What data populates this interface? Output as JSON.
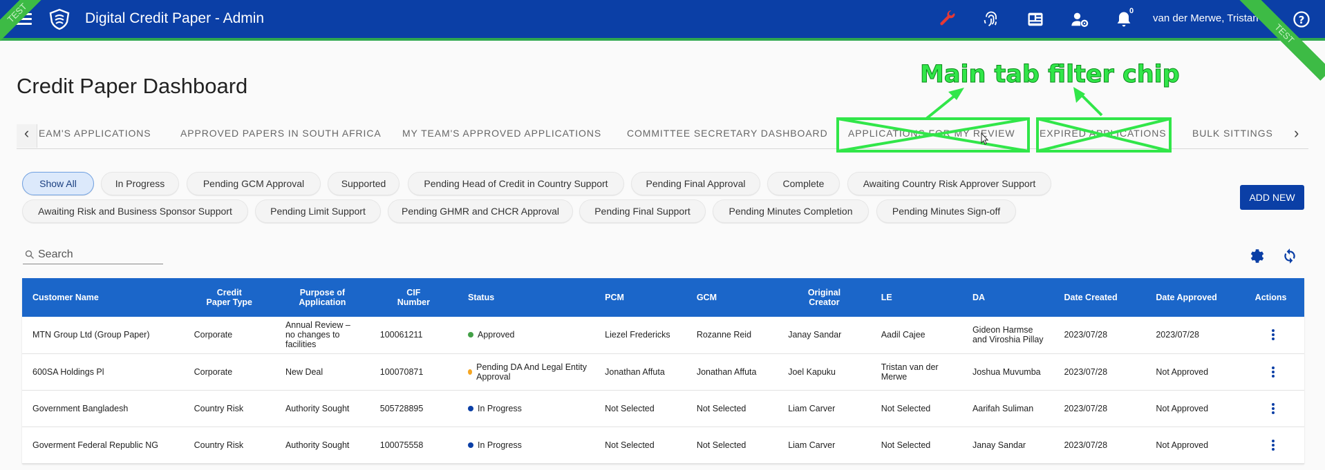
{
  "header": {
    "app_title": "Digital Credit Paper - Admin",
    "user_name": "van der Merwe, Tristan T",
    "notification_count": "0",
    "env_ribbon_left": "TEST",
    "env_ribbon_right": "TEST",
    "icons": [
      "menu-icon",
      "bank-shield-logo",
      "wrench-icon",
      "fingerprint-icon",
      "id-card-icon",
      "user-settings-icon",
      "bell-icon",
      "help-icon"
    ],
    "wrench_color": "#e53935",
    "bar_color": "#0b3fa6",
    "stripe_color": "#2fa84f"
  },
  "page": {
    "title": "Credit Paper Dashboard"
  },
  "tabs": [
    {
      "label": "EAM'S APPLICATIONS"
    },
    {
      "label": "APPROVED PAPERS IN SOUTH AFRICA"
    },
    {
      "label": "MY TEAM'S APPROVED APPLICATIONS"
    },
    {
      "label": "COMMITTEE SECRETARY DASHBOARD"
    },
    {
      "label": "APPLICATIONS FOR MY REVIEW"
    },
    {
      "label": "EXPIRED APPLICATIONS"
    },
    {
      "label": "BULK SITTINGS"
    }
  ],
  "annotation": {
    "label": "Main tab filter chip",
    "color": "#31e649"
  },
  "filters": {
    "active": "Show All",
    "chips": [
      "Show All",
      "In Progress",
      "Pending GCM Approval",
      "Supported",
      "Pending Head of Credit in Country Support",
      "Pending Final Approval",
      "Complete",
      "Awaiting Country Risk Approver Support",
      "Awaiting Risk and Business Sponsor Support",
      "Pending Limit Support",
      "Pending GHMR and CHCR Approval",
      "Pending Final Support",
      "Pending Minutes Completion",
      "Pending Minutes Sign-off"
    ]
  },
  "actions": {
    "add_new_label": "ADD NEW"
  },
  "search": {
    "placeholder": "Search",
    "value": ""
  },
  "table": {
    "columns": [
      "Customer Name",
      "Credit Paper Type",
      "Purpose of Application",
      "CIF Number",
      "Status",
      "PCM",
      "GCM",
      "Original Creator",
      "LE",
      "DA",
      "Date Created",
      "Date Approved",
      "Actions"
    ],
    "rows": [
      {
        "customer": "MTN Group Ltd (Group Paper)",
        "type": "Corporate",
        "purpose": "Annual Review – no changes to facilities",
        "cif": "100061211",
        "status": "Approved",
        "status_color": "#43a047",
        "pcm": "Liezel Fredericks",
        "gcm": "Rozanne Reid",
        "creator": "Janay Sandar",
        "le": "Aadil Cajee",
        "da": "Gideon Harmse and Viroshia Pillay",
        "created": "2023/07/28",
        "approved": "2023/07/28"
      },
      {
        "customer": "600SA Holdings Pl",
        "type": "Corporate",
        "purpose": "New Deal",
        "cif": "100070871",
        "status": "Pending DA And Legal Entity Approval",
        "status_color": "#f5a623",
        "pcm": "Jonathan Affuta",
        "gcm": "Jonathan Affuta",
        "creator": "Joel Kapuku",
        "le": "Tristan van der Merwe",
        "da": "Joshua Muvumba",
        "created": "2023/07/28",
        "approved": "Not Approved"
      },
      {
        "customer": "Government Bangladesh",
        "type": "Country Risk",
        "purpose": "Authority Sought",
        "cif": "505728895",
        "status": "In Progress",
        "status_color": "#0b3fa6",
        "pcm": "Not Selected",
        "gcm": "Not Selected",
        "creator": "Liam Carver",
        "le": "Not Selected",
        "da": "Aarifah Suliman",
        "created": "2023/07/28",
        "approved": "Not Approved"
      },
      {
        "customer": "Goverment Federal Republic NG",
        "type": "Country Risk",
        "purpose": "Authority Sought",
        "cif": "100075558",
        "status": "In Progress",
        "status_color": "#0b3fa6",
        "pcm": "Not Selected",
        "gcm": "Not Selected",
        "creator": "Liam Carver",
        "le": "Not Selected",
        "da": "Janay Sandar",
        "created": "2023/07/28",
        "approved": "Not Approved"
      }
    ]
  }
}
